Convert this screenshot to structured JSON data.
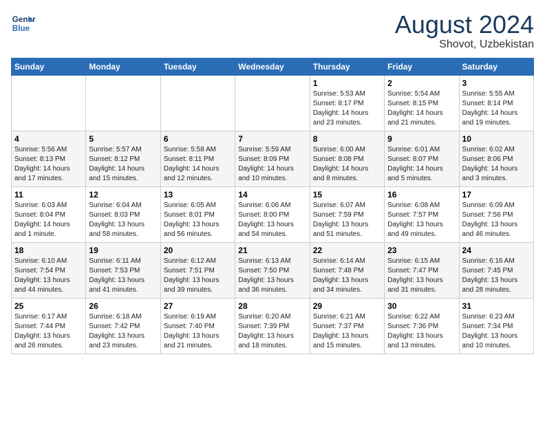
{
  "header": {
    "logo_line1": "General",
    "logo_line2": "Blue",
    "title": "August 2024",
    "subtitle": "Shovot, Uzbekistan"
  },
  "weekdays": [
    "Sunday",
    "Monday",
    "Tuesday",
    "Wednesday",
    "Thursday",
    "Friday",
    "Saturday"
  ],
  "weeks": [
    [
      {
        "day": "",
        "info": ""
      },
      {
        "day": "",
        "info": ""
      },
      {
        "day": "",
        "info": ""
      },
      {
        "day": "",
        "info": ""
      },
      {
        "day": "1",
        "info": "Sunrise: 5:53 AM\nSunset: 8:17 PM\nDaylight: 14 hours\nand 23 minutes."
      },
      {
        "day": "2",
        "info": "Sunrise: 5:54 AM\nSunset: 8:15 PM\nDaylight: 14 hours\nand 21 minutes."
      },
      {
        "day": "3",
        "info": "Sunrise: 5:55 AM\nSunset: 8:14 PM\nDaylight: 14 hours\nand 19 minutes."
      }
    ],
    [
      {
        "day": "4",
        "info": "Sunrise: 5:56 AM\nSunset: 8:13 PM\nDaylight: 14 hours\nand 17 minutes."
      },
      {
        "day": "5",
        "info": "Sunrise: 5:57 AM\nSunset: 8:12 PM\nDaylight: 14 hours\nand 15 minutes."
      },
      {
        "day": "6",
        "info": "Sunrise: 5:58 AM\nSunset: 8:11 PM\nDaylight: 14 hours\nand 12 minutes."
      },
      {
        "day": "7",
        "info": "Sunrise: 5:59 AM\nSunset: 8:09 PM\nDaylight: 14 hours\nand 10 minutes."
      },
      {
        "day": "8",
        "info": "Sunrise: 6:00 AM\nSunset: 8:08 PM\nDaylight: 14 hours\nand 8 minutes."
      },
      {
        "day": "9",
        "info": "Sunrise: 6:01 AM\nSunset: 8:07 PM\nDaylight: 14 hours\nand 5 minutes."
      },
      {
        "day": "10",
        "info": "Sunrise: 6:02 AM\nSunset: 8:06 PM\nDaylight: 14 hours\nand 3 minutes."
      }
    ],
    [
      {
        "day": "11",
        "info": "Sunrise: 6:03 AM\nSunset: 8:04 PM\nDaylight: 14 hours\nand 1 minute."
      },
      {
        "day": "12",
        "info": "Sunrise: 6:04 AM\nSunset: 8:03 PM\nDaylight: 13 hours\nand 58 minutes."
      },
      {
        "day": "13",
        "info": "Sunrise: 6:05 AM\nSunset: 8:01 PM\nDaylight: 13 hours\nand 56 minutes."
      },
      {
        "day": "14",
        "info": "Sunrise: 6:06 AM\nSunset: 8:00 PM\nDaylight: 13 hours\nand 54 minutes."
      },
      {
        "day": "15",
        "info": "Sunrise: 6:07 AM\nSunset: 7:59 PM\nDaylight: 13 hours\nand 51 minutes."
      },
      {
        "day": "16",
        "info": "Sunrise: 6:08 AM\nSunset: 7:57 PM\nDaylight: 13 hours\nand 49 minutes."
      },
      {
        "day": "17",
        "info": "Sunrise: 6:09 AM\nSunset: 7:56 PM\nDaylight: 13 hours\nand 46 minutes."
      }
    ],
    [
      {
        "day": "18",
        "info": "Sunrise: 6:10 AM\nSunset: 7:54 PM\nDaylight: 13 hours\nand 44 minutes."
      },
      {
        "day": "19",
        "info": "Sunrise: 6:11 AM\nSunset: 7:53 PM\nDaylight: 13 hours\nand 41 minutes."
      },
      {
        "day": "20",
        "info": "Sunrise: 6:12 AM\nSunset: 7:51 PM\nDaylight: 13 hours\nand 39 minutes."
      },
      {
        "day": "21",
        "info": "Sunrise: 6:13 AM\nSunset: 7:50 PM\nDaylight: 13 hours\nand 36 minutes."
      },
      {
        "day": "22",
        "info": "Sunrise: 6:14 AM\nSunset: 7:48 PM\nDaylight: 13 hours\nand 34 minutes."
      },
      {
        "day": "23",
        "info": "Sunrise: 6:15 AM\nSunset: 7:47 PM\nDaylight: 13 hours\nand 31 minutes."
      },
      {
        "day": "24",
        "info": "Sunrise: 6:16 AM\nSunset: 7:45 PM\nDaylight: 13 hours\nand 28 minutes."
      }
    ],
    [
      {
        "day": "25",
        "info": "Sunrise: 6:17 AM\nSunset: 7:44 PM\nDaylight: 13 hours\nand 26 minutes."
      },
      {
        "day": "26",
        "info": "Sunrise: 6:18 AM\nSunset: 7:42 PM\nDaylight: 13 hours\nand 23 minutes."
      },
      {
        "day": "27",
        "info": "Sunrise: 6:19 AM\nSunset: 7:40 PM\nDaylight: 13 hours\nand 21 minutes."
      },
      {
        "day": "28",
        "info": "Sunrise: 6:20 AM\nSunset: 7:39 PM\nDaylight: 13 hours\nand 18 minutes."
      },
      {
        "day": "29",
        "info": "Sunrise: 6:21 AM\nSunset: 7:37 PM\nDaylight: 13 hours\nand 15 minutes."
      },
      {
        "day": "30",
        "info": "Sunrise: 6:22 AM\nSunset: 7:36 PM\nDaylight: 13 hours\nand 13 minutes."
      },
      {
        "day": "31",
        "info": "Sunrise: 6:23 AM\nSunset: 7:34 PM\nDaylight: 13 hours\nand 10 minutes."
      }
    ]
  ]
}
